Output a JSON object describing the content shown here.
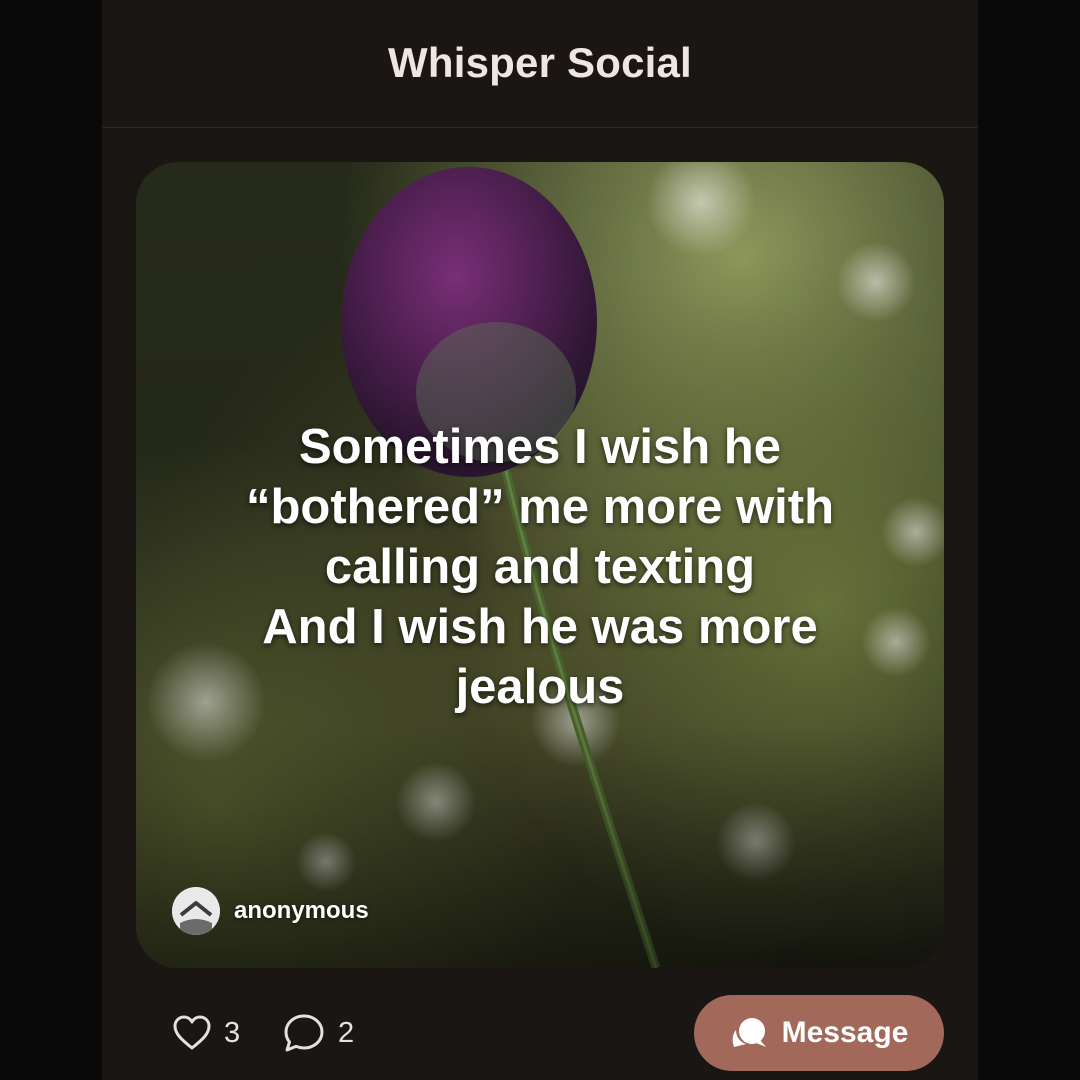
{
  "app": {
    "title": "Whisper Social"
  },
  "post": {
    "text": "Sometimes I wish he\n“bothered” me more with\ncalling and texting\nAnd I wish he was more\njealous",
    "author": "anonymous",
    "background_image": "blurred purple allium flower on green stem with bokeh"
  },
  "actions": {
    "likes": "3",
    "comments": "2",
    "message_label": "Message",
    "icons": {
      "like": "heart-outline-icon",
      "comment": "speech-bubble-outline-icon",
      "message": "chat-bubbles-icon"
    }
  },
  "colors": {
    "page_background": "#0a0909",
    "panel_background": "#1a1614",
    "accent": "#a2695a",
    "text_light": "#efe6df"
  }
}
